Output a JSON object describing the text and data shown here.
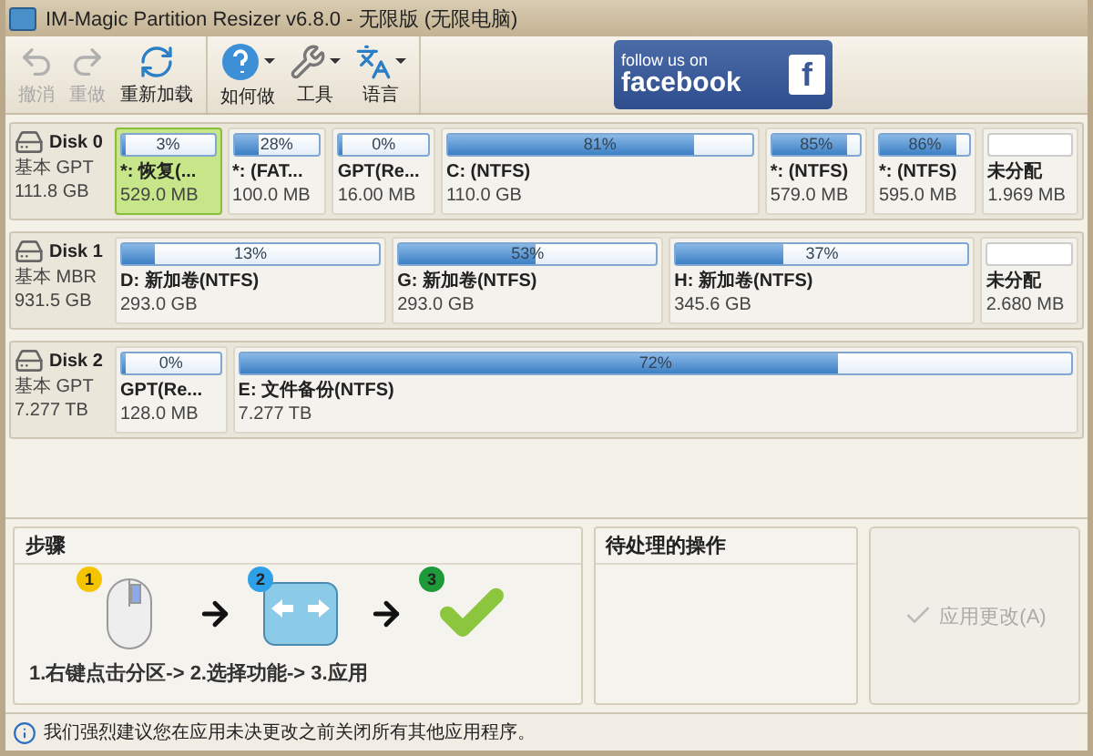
{
  "window": {
    "title": "IM-Magic Partition Resizer v6.8.0 - 无限版 (无限电脑)"
  },
  "toolbar": [
    {
      "kind": "undo",
      "label": "撤消",
      "disabled": true,
      "dropdown": false
    },
    {
      "kind": "redo",
      "label": "重做",
      "disabled": true,
      "dropdown": false
    },
    {
      "kind": "reload",
      "label": "重新加载",
      "disabled": false,
      "dropdown": false
    },
    {
      "kind": "help",
      "label": "如何做",
      "disabled": false,
      "dropdown": true
    },
    {
      "kind": "tools",
      "label": "工具",
      "disabled": false,
      "dropdown": true
    },
    {
      "kind": "language",
      "label": "语言",
      "disabled": false,
      "dropdown": true
    }
  ],
  "banner": {
    "line1": "follow us on",
    "line2": "facebook",
    "logo": "f"
  },
  "disks": [
    {
      "name": "Disk 0",
      "type": "基本 GPT",
      "size": "111.8 GB",
      "partitions": [
        {
          "kind": "partition",
          "percent": "3%",
          "level": 0.03,
          "name": "*: 恢复(...",
          "size": "529.0 MB",
          "selected": true
        },
        {
          "kind": "partition",
          "percent": "28%",
          "level": 0.28,
          "name": "*: (FAT...",
          "size": "100.0 MB",
          "selected": false
        },
        {
          "kind": "partition",
          "percent": "0%",
          "level": 0,
          "name": "GPT(Re...",
          "size": "16.00 MB",
          "selected": false
        },
        {
          "kind": "partition",
          "percent": "81%",
          "level": 0.81,
          "name": "C: (NTFS)",
          "size": "110.0 GB",
          "selected": false
        },
        {
          "kind": "partition",
          "percent": "85%",
          "level": 0.85,
          "name": "*: (NTFS)",
          "size": "579.0 MB",
          "selected": false
        },
        {
          "kind": "partition",
          "percent": "86%",
          "level": 0.86,
          "name": "*: (NTFS)",
          "size": "595.0 MB",
          "selected": false
        },
        {
          "kind": "unallocated",
          "name": "未分配",
          "size": "1.969 MB",
          "selected": false
        }
      ]
    },
    {
      "name": "Disk 1",
      "type": "基本 MBR",
      "size": "931.5 GB",
      "partitions": [
        {
          "kind": "partition",
          "percent": "13%",
          "level": 0.13,
          "name": "D: 新加卷(NTFS)",
          "size": "293.0 GB",
          "selected": false
        },
        {
          "kind": "partition",
          "percent": "53%",
          "level": 0.53,
          "name": "G: 新加卷(NTFS)",
          "size": "293.0 GB",
          "selected": false
        },
        {
          "kind": "partition",
          "percent": "37%",
          "level": 0.37,
          "name": "H: 新加卷(NTFS)",
          "size": "345.6 GB",
          "selected": false
        },
        {
          "kind": "unallocated",
          "name": "未分配",
          "size": "2.680 MB",
          "selected": false
        }
      ]
    },
    {
      "name": "Disk 2",
      "type": "基本 GPT",
      "size": "7.277 TB",
      "partitions": [
        {
          "kind": "partition",
          "percent": "0%",
          "level": 0,
          "name": "GPT(Re...",
          "size": "128.0 MB",
          "selected": false
        },
        {
          "kind": "partition",
          "percent": "72%",
          "level": 0.72,
          "name": "E: 文件备份(NTFS)",
          "size": "7.277 TB",
          "selected": false
        }
      ]
    }
  ],
  "steps_panel": {
    "title": "步骤",
    "badges": [
      "1",
      "2",
      "3"
    ],
    "caption": "1.右键点击分区-> 2.选择功能-> 3.应用"
  },
  "pending_panel": {
    "title": "待处理的操作"
  },
  "apply_button": {
    "label": "应用更改(A)",
    "disabled": true
  },
  "status_bar": {
    "message": "我们强烈建议您在应用未决更改之前关闭所有其他应用程序。"
  }
}
